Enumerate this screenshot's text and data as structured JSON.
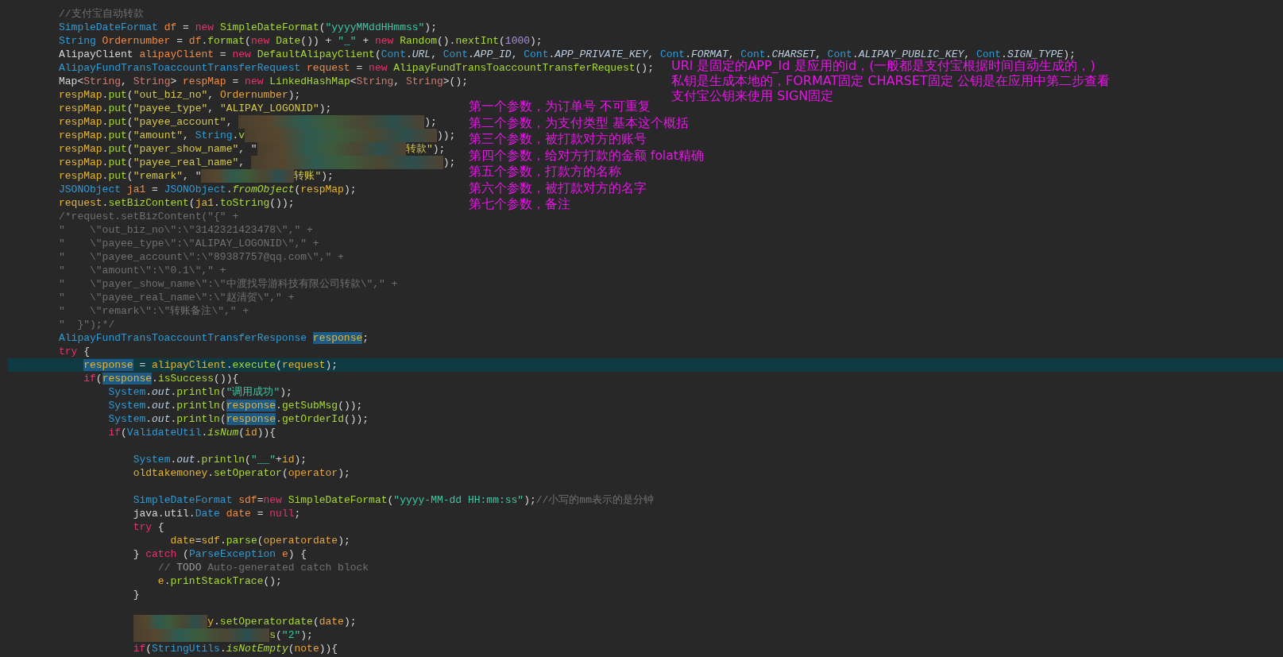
{
  "editor": {
    "lines": [
      {
        "current": false,
        "tokens": [
          {
            "kind": "comment",
            "text": "//支付宝自动转款"
          }
        ]
      },
      {
        "current": false,
        "tokens": [
          {
            "kind": "type",
            "text": "SimpleDateFormat "
          },
          {
            "kind": "decl",
            "text": "df"
          },
          {
            "kind": "plain",
            "text": " = "
          },
          {
            "kind": "kw",
            "text": "new "
          },
          {
            "kind": "call",
            "text": "SimpleDateFormat"
          },
          {
            "kind": "plain",
            "text": "("
          },
          {
            "kind": "str",
            "text": "\"yyyyMMddHHmmss\""
          },
          {
            "kind": "plain",
            "text": ");"
          }
        ]
      },
      {
        "current": false,
        "tokens": [
          {
            "kind": "type",
            "text": "String "
          },
          {
            "kind": "decl",
            "text": "Ordernumber"
          },
          {
            "kind": "plain",
            "text": " = "
          },
          {
            "kind": "decl",
            "text": "df"
          },
          {
            "kind": "plain",
            "text": "."
          },
          {
            "kind": "call",
            "text": "format"
          },
          {
            "kind": "plain",
            "text": "("
          },
          {
            "kind": "kw",
            "text": "new "
          },
          {
            "kind": "call",
            "text": "Date"
          },
          {
            "kind": "plain",
            "text": "()) + "
          },
          {
            "kind": "str",
            "text": "\"_\""
          },
          {
            "kind": "plain",
            "text": " + "
          },
          {
            "kind": "kw",
            "text": "new "
          },
          {
            "kind": "call",
            "text": "Random"
          },
          {
            "kind": "plain",
            "text": "()."
          },
          {
            "kind": "call",
            "text": "nextInt"
          },
          {
            "kind": "plain",
            "text": "("
          },
          {
            "kind": "num",
            "text": "1000"
          },
          {
            "kind": "plain",
            "text": ");"
          }
        ]
      },
      {
        "current": false,
        "tokens": [
          {
            "kind": "plain",
            "text": "AlipayClient "
          },
          {
            "kind": "decl",
            "text": "alipayClient"
          },
          {
            "kind": "plain",
            "text": " = "
          },
          {
            "kind": "kw",
            "text": "new "
          },
          {
            "kind": "call",
            "text": "DefaultAlipayClient"
          },
          {
            "kind": "plain",
            "text": "("
          },
          {
            "kind": "type",
            "text": "Cont"
          },
          {
            "kind": "plain",
            "text": "."
          },
          {
            "kind": "stat",
            "text": "URL"
          },
          {
            "kind": "plain",
            "text": ", "
          },
          {
            "kind": "type",
            "text": "Cont"
          },
          {
            "kind": "plain",
            "text": "."
          },
          {
            "kind": "stat",
            "text": "APP_ID"
          },
          {
            "kind": "plain",
            "text": ", "
          },
          {
            "kind": "type",
            "text": "Cont"
          },
          {
            "kind": "plain",
            "text": "."
          },
          {
            "kind": "stat",
            "text": "APP_PRIVATE_KEY"
          },
          {
            "kind": "plain",
            "text": ", "
          },
          {
            "kind": "type",
            "text": "Cont"
          },
          {
            "kind": "plain",
            "text": "."
          },
          {
            "kind": "stat",
            "text": "FORMAT"
          },
          {
            "kind": "plain",
            "text": ", "
          },
          {
            "kind": "type",
            "text": "Cont"
          },
          {
            "kind": "plain",
            "text": "."
          },
          {
            "kind": "stat",
            "text": "CHARSET"
          },
          {
            "kind": "plain",
            "text": ", "
          },
          {
            "kind": "type",
            "text": "Cont"
          },
          {
            "kind": "plain",
            "text": "."
          },
          {
            "kind": "stat",
            "text": "ALIPAY_PUBLIC_KEY"
          },
          {
            "kind": "plain",
            "text": ", "
          },
          {
            "kind": "type",
            "text": "Cont"
          },
          {
            "kind": "plain",
            "text": "."
          },
          {
            "kind": "stat",
            "text": "SIGN_TYPE"
          },
          {
            "kind": "plain",
            "text": ");"
          }
        ]
      },
      {
        "current": false,
        "tokens": [
          {
            "kind": "type",
            "text": "AlipayFundTransToaccountTransferRequest "
          },
          {
            "kind": "decl",
            "text": "request"
          },
          {
            "kind": "plain",
            "text": " = "
          },
          {
            "kind": "kw",
            "text": "new "
          },
          {
            "kind": "call",
            "text": "AlipayFundTransToaccountTransferRequest"
          },
          {
            "kind": "plain",
            "text": "();"
          }
        ]
      },
      {
        "current": false,
        "tokens": [
          {
            "kind": "plain",
            "text": "Map<"
          },
          {
            "kind": "gen",
            "text": "String"
          },
          {
            "kind": "plain",
            "text": ", "
          },
          {
            "kind": "gen",
            "text": "String"
          },
          {
            "kind": "plain",
            "text": "> "
          },
          {
            "kind": "decl",
            "text": "respMap"
          },
          {
            "kind": "plain",
            "text": " = "
          },
          {
            "kind": "kw",
            "text": "new "
          },
          {
            "kind": "call",
            "text": "LinkedHashMap"
          },
          {
            "kind": "plain",
            "text": "<"
          },
          {
            "kind": "gen",
            "text": "String"
          },
          {
            "kind": "plain",
            "text": ", "
          },
          {
            "kind": "gen",
            "text": "String"
          },
          {
            "kind": "plain",
            "text": ">();"
          }
        ]
      },
      {
        "current": false,
        "tokens": [
          {
            "kind": "var",
            "text": "respMap"
          },
          {
            "kind": "plain",
            "text": "."
          },
          {
            "kind": "call",
            "text": "put"
          },
          {
            "kind": "plain",
            "text": "("
          },
          {
            "kind": "key",
            "text": "\"out_biz_no\""
          },
          {
            "kind": "plain",
            "text": ", "
          },
          {
            "kind": "param",
            "text": "Ordernumber"
          },
          {
            "kind": "plain",
            "text": ");"
          }
        ]
      },
      {
        "current": false,
        "tokens": [
          {
            "kind": "var",
            "text": "respMap"
          },
          {
            "kind": "plain",
            "text": "."
          },
          {
            "kind": "call",
            "text": "put"
          },
          {
            "kind": "plain",
            "text": "("
          },
          {
            "kind": "key",
            "text": "\"payee_type\""
          },
          {
            "kind": "plain",
            "text": ", "
          },
          {
            "kind": "key",
            "text": "\"ALIPAY_LOGONID\""
          },
          {
            "kind": "plain",
            "text": ");"
          }
        ]
      },
      {
        "current": false,
        "tokens": [
          {
            "kind": "var",
            "text": "respMap"
          },
          {
            "kind": "plain",
            "text": "."
          },
          {
            "kind": "call",
            "text": "put"
          },
          {
            "kind": "plain",
            "text": "("
          },
          {
            "kind": "key",
            "text": "\"payee_account\""
          },
          {
            "kind": "plain",
            "text": ", "
          },
          {
            "kind": "redacted"
          },
          {
            "kind": "plain",
            "text": ");"
          }
        ]
      },
      {
        "current": false,
        "tokens": [
          {
            "kind": "var",
            "text": "respMap"
          },
          {
            "kind": "plain",
            "text": "."
          },
          {
            "kind": "call",
            "text": "put"
          },
          {
            "kind": "plain",
            "text": "("
          },
          {
            "kind": "key",
            "text": "\"amount\""
          },
          {
            "kind": "plain",
            "text": ", "
          },
          {
            "kind": "type",
            "text": "String"
          },
          {
            "kind": "plain",
            "text": "."
          },
          {
            "kind": "call",
            "text": "v"
          },
          {
            "kind": "redacted"
          },
          {
            "kind": "plain",
            "text": "));"
          }
        ]
      },
      {
        "current": false,
        "tokens": [
          {
            "kind": "var",
            "text": "respMap"
          },
          {
            "kind": "plain",
            "text": "."
          },
          {
            "kind": "call",
            "text": "put"
          },
          {
            "kind": "plain",
            "text": "("
          },
          {
            "kind": "key",
            "text": "\"payer_show_name\""
          },
          {
            "kind": "plain",
            "text": ", \""
          },
          {
            "kind": "redacted"
          },
          {
            "kind": "key",
            "text": "转款\""
          },
          {
            "kind": "plain",
            "text": ");"
          }
        ]
      },
      {
        "current": false,
        "tokens": [
          {
            "kind": "var",
            "text": "respMap"
          },
          {
            "kind": "plain",
            "text": "."
          },
          {
            "kind": "call",
            "text": "put"
          },
          {
            "kind": "plain",
            "text": "("
          },
          {
            "kind": "key",
            "text": "\"payee_real_name\""
          },
          {
            "kind": "plain",
            "text": ", "
          },
          {
            "kind": "redacted"
          },
          {
            "kind": "plain",
            "text": ");"
          }
        ]
      },
      {
        "current": false,
        "tokens": [
          {
            "kind": "var",
            "text": "respMap"
          },
          {
            "kind": "plain",
            "text": "."
          },
          {
            "kind": "call",
            "text": "put"
          },
          {
            "kind": "plain",
            "text": "("
          },
          {
            "kind": "key",
            "text": "\"remark\""
          },
          {
            "kind": "plain",
            "text": ", \""
          },
          {
            "kind": "redacted"
          },
          {
            "kind": "key",
            "text": "转账\""
          },
          {
            "kind": "plain",
            "text": ");"
          }
        ]
      },
      {
        "current": false,
        "tokens": [
          {
            "kind": "type",
            "text": "JSONObject "
          },
          {
            "kind": "decl",
            "text": "ja1"
          },
          {
            "kind": "plain",
            "text": " = "
          },
          {
            "kind": "type",
            "text": "JSONObject"
          },
          {
            "kind": "plain",
            "text": "."
          },
          {
            "kind": "ital",
            "text": "fromObject"
          },
          {
            "kind": "plain",
            "text": "("
          },
          {
            "kind": "var",
            "text": "respMap"
          },
          {
            "kind": "plain",
            "text": ");"
          }
        ]
      },
      {
        "current": false,
        "tokens": [
          {
            "kind": "var",
            "text": "request"
          },
          {
            "kind": "plain",
            "text": "."
          },
          {
            "kind": "call",
            "text": "setBizContent"
          },
          {
            "kind": "plain",
            "text": "("
          },
          {
            "kind": "var",
            "text": "ja1"
          },
          {
            "kind": "plain",
            "text": "."
          },
          {
            "kind": "call",
            "text": "toString"
          },
          {
            "kind": "plain",
            "text": "());"
          }
        ]
      },
      {
        "current": false,
        "tokens": [
          {
            "kind": "comment",
            "text": "/*request.setBizContent(\"{\" +"
          }
        ]
      },
      {
        "current": false,
        "tokens": [
          {
            "kind": "comment",
            "text": "\"    \\\"out_biz_no\\\":\\\"3142321423478\\\",\" +"
          }
        ]
      },
      {
        "current": false,
        "tokens": [
          {
            "kind": "comment",
            "text": "\"    \\\"payee_type\\\":\\\"ALIPAY_LOGONID\\\",\" +"
          }
        ]
      },
      {
        "current": false,
        "tokens": [
          {
            "kind": "comment",
            "text": "\"    \\\"payee_account\\\":\\\"89387757@qq.com\\\",\" +"
          }
        ]
      },
      {
        "current": false,
        "tokens": [
          {
            "kind": "comment",
            "text": "\"    \\\"amount\\\":\\\"0.1\\\",\" +"
          }
        ]
      },
      {
        "current": false,
        "tokens": [
          {
            "kind": "comment",
            "text": "\"    \\\"payer_show_name\\\":\\\"中渡找导游科技有限公司转款\\\",\" +"
          }
        ]
      },
      {
        "current": false,
        "tokens": [
          {
            "kind": "comment",
            "text": "\"    \\\"payee_real_name\\\":\\\"赵清贺\\\",\" +"
          }
        ]
      },
      {
        "current": false,
        "tokens": [
          {
            "kind": "comment",
            "text": "\"    \\\"remark\\\":\\\"转账备注\\\",\" +"
          }
        ]
      },
      {
        "current": false,
        "tokens": [
          {
            "kind": "comment",
            "text": "\"  }\");*/"
          }
        ]
      },
      {
        "current": false,
        "tokens": [
          {
            "kind": "type",
            "text": "AlipayFundTransToaccountTransferResponse "
          },
          {
            "kind": "sel",
            "text": "response"
          },
          {
            "kind": "plain",
            "text": ";"
          }
        ]
      },
      {
        "current": false,
        "tokens": [
          {
            "kind": "kw",
            "text": "try"
          },
          {
            "kind": "plain",
            "text": " {"
          }
        ]
      },
      {
        "current": true,
        "tokens": [
          {
            "kind": "sel",
            "text": "    response"
          },
          {
            "kind": "plain",
            "text": " = "
          },
          {
            "kind": "var",
            "text": "alipayClient"
          },
          {
            "kind": "plain",
            "text": "."
          },
          {
            "kind": "call",
            "text": "execute"
          },
          {
            "kind": "plain",
            "text": "("
          },
          {
            "kind": "var",
            "text": "request"
          },
          {
            "kind": "plain",
            "text": ");"
          }
        ]
      },
      {
        "current": false,
        "tokens": [
          {
            "kind": "kw",
            "text": "    if"
          },
          {
            "kind": "plain",
            "text": "("
          },
          {
            "kind": "sel",
            "text": "response"
          },
          {
            "kind": "plain",
            "text": "."
          },
          {
            "kind": "call",
            "text": "isSuccess"
          },
          {
            "kind": "plain",
            "text": "()){"
          }
        ]
      },
      {
        "current": false,
        "tokens": [
          {
            "kind": "type",
            "text": "        System"
          },
          {
            "kind": "plain",
            "text": "."
          },
          {
            "kind": "stat",
            "text": "out"
          },
          {
            "kind": "plain",
            "text": "."
          },
          {
            "kind": "call",
            "text": "println"
          },
          {
            "kind": "plain",
            "text": "("
          },
          {
            "kind": "str",
            "text": "\"调用成功\""
          },
          {
            "kind": "plain",
            "text": ");"
          }
        ]
      },
      {
        "current": false,
        "tokens": [
          {
            "kind": "type",
            "text": "        System"
          },
          {
            "kind": "plain",
            "text": "."
          },
          {
            "kind": "stat",
            "text": "out"
          },
          {
            "kind": "plain",
            "text": "."
          },
          {
            "kind": "call",
            "text": "println"
          },
          {
            "kind": "plain",
            "text": "("
          },
          {
            "kind": "sel",
            "text": "response"
          },
          {
            "kind": "plain",
            "text": "."
          },
          {
            "kind": "call",
            "text": "getSubMsg"
          },
          {
            "kind": "plain",
            "text": "());"
          }
        ]
      },
      {
        "current": false,
        "tokens": [
          {
            "kind": "type",
            "text": "        System"
          },
          {
            "kind": "plain",
            "text": "."
          },
          {
            "kind": "stat",
            "text": "out"
          },
          {
            "kind": "plain",
            "text": "."
          },
          {
            "kind": "call",
            "text": "println"
          },
          {
            "kind": "plain",
            "text": "("
          },
          {
            "kind": "sel",
            "text": "response"
          },
          {
            "kind": "plain",
            "text": "."
          },
          {
            "kind": "call",
            "text": "getOrderId"
          },
          {
            "kind": "plain",
            "text": "());"
          }
        ]
      },
      {
        "current": false,
        "tokens": [
          {
            "kind": "kw",
            "text": "        if"
          },
          {
            "kind": "plain",
            "text": "("
          },
          {
            "kind": "type",
            "text": "ValidateUtil"
          },
          {
            "kind": "plain",
            "text": "."
          },
          {
            "kind": "ital",
            "text": "isNum"
          },
          {
            "kind": "plain",
            "text": "("
          },
          {
            "kind": "param",
            "text": "id"
          },
          {
            "kind": "plain",
            "text": ")){"
          }
        ]
      },
      {
        "current": false
      },
      {
        "current": false,
        "tokens": [
          {
            "kind": "type",
            "text": "            System"
          },
          {
            "kind": "plain",
            "text": "."
          },
          {
            "kind": "stat",
            "text": "out"
          },
          {
            "kind": "plain",
            "text": "."
          },
          {
            "kind": "call",
            "text": "println"
          },
          {
            "kind": "plain",
            "text": "("
          },
          {
            "kind": "str",
            "text": "\"__\""
          },
          {
            "kind": "plain",
            "text": "+"
          },
          {
            "kind": "param",
            "text": "id"
          },
          {
            "kind": "plain",
            "text": ");"
          }
        ]
      },
      {
        "current": false,
        "tokens": [
          {
            "kind": "var",
            "text": "            oldtakemoney"
          },
          {
            "kind": "plain",
            "text": "."
          },
          {
            "kind": "call",
            "text": "setOperator"
          },
          {
            "kind": "plain",
            "text": "("
          },
          {
            "kind": "param",
            "text": "operator"
          },
          {
            "kind": "plain",
            "text": ");"
          }
        ]
      },
      {
        "current": false
      },
      {
        "current": false,
        "tokens": [
          {
            "kind": "type",
            "text": "            SimpleDateFormat "
          },
          {
            "kind": "decl",
            "text": "sdf"
          },
          {
            "kind": "plain",
            "text": "="
          },
          {
            "kind": "kw",
            "text": "new "
          },
          {
            "kind": "call",
            "text": "SimpleDateFormat"
          },
          {
            "kind": "plain",
            "text": "("
          },
          {
            "kind": "str",
            "text": "\"yyyy-MM-dd HH:mm:ss\""
          },
          {
            "kind": "plain",
            "text": ");"
          },
          {
            "kind": "comment",
            "text": "//小写的mm表示的是分钟"
          }
        ]
      },
      {
        "current": false,
        "tokens": [
          {
            "kind": "plain",
            "text": "            java.util."
          },
          {
            "kind": "type",
            "text": "Date "
          },
          {
            "kind": "decl",
            "text": "date"
          },
          {
            "kind": "plain",
            "text": " = "
          },
          {
            "kind": "kw",
            "text": "null"
          },
          {
            "kind": "plain",
            "text": ";"
          }
        ]
      },
      {
        "current": false,
        "tokens": [
          {
            "kind": "kw",
            "text": "            try"
          },
          {
            "kind": "plain",
            "text": " {"
          }
        ]
      },
      {
        "current": false,
        "tokens": [
          {
            "kind": "var",
            "text": "                  date"
          },
          {
            "kind": "plain",
            "text": "="
          },
          {
            "kind": "var",
            "text": "sdf"
          },
          {
            "kind": "plain",
            "text": "."
          },
          {
            "kind": "call",
            "text": "parse"
          },
          {
            "kind": "plain",
            "text": "("
          },
          {
            "kind": "param",
            "text": "operatordate"
          },
          {
            "kind": "plain",
            "text": ");"
          }
        ]
      },
      {
        "current": false,
        "tokens": [
          {
            "kind": "plain",
            "text": "            } "
          },
          {
            "kind": "kw",
            "text": "catch"
          },
          {
            "kind": "plain",
            "text": " ("
          },
          {
            "kind": "type",
            "text": "ParseException "
          },
          {
            "kind": "decl",
            "text": "e"
          },
          {
            "kind": "plain",
            "text": ") {"
          }
        ]
      },
      {
        "current": false,
        "tokens": [
          {
            "kind": "comment",
            "text": "                // "
          },
          {
            "kind": "todo",
            "text": "TODO"
          },
          {
            "kind": "comment",
            "text": " Auto-generated catch block"
          }
        ]
      },
      {
        "current": false,
        "tokens": [
          {
            "kind": "var",
            "text": "                e"
          },
          {
            "kind": "plain",
            "text": "."
          },
          {
            "kind": "call",
            "text": "printStackTrace"
          },
          {
            "kind": "plain",
            "text": "();"
          }
        ]
      },
      {
        "current": false,
        "tokens": [
          {
            "kind": "plain",
            "text": "            }"
          }
        ]
      },
      {
        "current": false
      },
      {
        "current": false,
        "tokens": [
          {
            "kind": "redacted"
          },
          {
            "kind": "var",
            "text": "y"
          },
          {
            "kind": "plain",
            "text": "."
          },
          {
            "kind": "call",
            "text": "setOperatordate"
          },
          {
            "kind": "plain",
            "text": "("
          },
          {
            "kind": "param",
            "text": "date"
          },
          {
            "kind": "plain",
            "text": ");"
          }
        ]
      },
      {
        "current": false,
        "tokens": [
          {
            "kind": "redacted"
          },
          {
            "kind": "call",
            "text": "s"
          },
          {
            "kind": "plain",
            "text": "("
          },
          {
            "kind": "str",
            "text": "\"2\""
          },
          {
            "kind": "plain",
            "text": ");"
          }
        ]
      },
      {
        "current": false,
        "tokens": [
          {
            "kind": "kw",
            "text": "            if"
          },
          {
            "kind": "plain",
            "text": "("
          },
          {
            "kind": "type",
            "text": "StringUtils"
          },
          {
            "kind": "plain",
            "text": "."
          },
          {
            "kind": "ital",
            "text": "isNotEmpty"
          },
          {
            "kind": "plain",
            "text": "("
          },
          {
            "kind": "param",
            "text": "note"
          },
          {
            "kind": "plain",
            "text": ")){"
          }
        ]
      }
    ]
  },
  "annotations": [
    {
      "kind": "config",
      "lines": [
        "URl 是固定的APP_Id 是应用的id，(一般都是支付宝根据时间自动生成的，)",
        "私钥是生成本地的，FORMAT固定 CHARSET固定 公钥是在应用中第二步查看",
        "支付宝公钥来使用 SIGN固定"
      ]
    },
    {
      "kind": "params",
      "lines": [
        "第一个参数，为订单号 不可重复",
        "第二个参数，为支付类型 基本这个概括",
        "第三个参数，被打款对方的账号",
        "第四个参数，给对方打款的金额 folat精确",
        "第五个参数，打款方的名称",
        "第六个参数，被打款对方的名字",
        "第七个参数，备注"
      ]
    }
  ]
}
